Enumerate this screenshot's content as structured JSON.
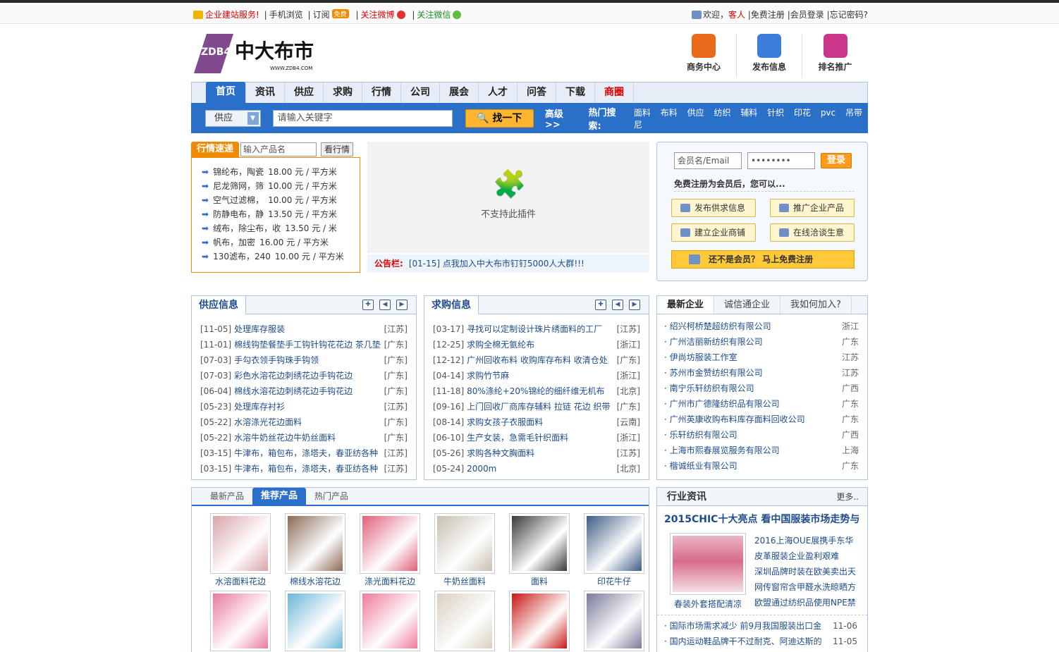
{
  "topbar": {
    "left": {
      "service": "企业建站服务!",
      "mobile": "手机浏览",
      "subscribe": "订阅",
      "free_badge": "免费",
      "weibo": "关注微博",
      "wechat": "关注微信"
    },
    "right": {
      "welcome": "欢迎，",
      "guest": "客人",
      "register": "免费注册",
      "login": "会员登录",
      "forgot": "忘记密码?"
    }
  },
  "header": {
    "logo_text": "中大布市",
    "logo_sub": "ZDB4",
    "logo_url_text": "WWW.ZDB4.COM",
    "icons": [
      {
        "label": "商务中心",
        "color": "#e86a1a"
      },
      {
        "label": "发布信息",
        "color": "#3b7dd8"
      },
      {
        "label": "排名推广",
        "color": "#c9368a"
      }
    ]
  },
  "nav": {
    "items": [
      "首页",
      "资讯",
      "供应",
      "求购",
      "行情",
      "公司",
      "展会",
      "人才",
      "问答",
      "下载",
      "商圈"
    ]
  },
  "search": {
    "category": "供应",
    "placeholder": "请输入关键字",
    "button": "找一下",
    "advanced": "高级 >>",
    "hot_label": "热门搜索:",
    "hot_words": [
      "面料",
      "布料",
      "供应",
      "纺织",
      "辅料",
      "针织",
      "印花",
      "pvc",
      "吊带",
      "尼"
    ]
  },
  "market": {
    "tab": "行情速递",
    "input_placeholder": "输入产品名",
    "button": "看行情",
    "rows": [
      {
        "name": "锦纶布，陶瓷",
        "price": "18.00 元 / 平方米"
      },
      {
        "name": "尼龙筛网，筛",
        "price": "10.00 元 / 平方米"
      },
      {
        "name": "空气过滤棉，",
        "price": "10.00 元 / 平方米"
      },
      {
        "name": "防静电布，静",
        "price": "13.50 元 / 平方米"
      },
      {
        "name": "绒布，除尘布，收",
        "price": "13.50 元 / 米"
      },
      {
        "name": "帆布，加密",
        "price": "16.00 元 / 平方米"
      },
      {
        "name": "130滤布，240",
        "price": "10.00 元 / 平方米"
      }
    ]
  },
  "plugin": {
    "text": "不支持此插件"
  },
  "notice": {
    "label": "公告栏:",
    "text": "[01-15] 点我加入中大布市钉钉5000人大群!!!"
  },
  "login": {
    "user_placeholder": "会员名/Email",
    "password_value": "••••••••",
    "button": "登录",
    "message": "免费注册为会员后，您可以...",
    "actions": [
      "发布供求信息",
      "推广企业产品",
      "建立企业商铺",
      "在线洽谈生意"
    ],
    "register": "还不是会员？ 马上免费注册"
  },
  "supply": {
    "title": "供应信息",
    "items": [
      {
        "date": "[11-05]",
        "title": "处理库存服装",
        "region": "[江苏]"
      },
      {
        "date": "[11-01]",
        "title": "棉线钩垫餐垫手工钩针钩花花边 茶几垫",
        "region": "[广东]"
      },
      {
        "date": "[07-03]",
        "title": "手勾衣领手钩珠手钩领",
        "region": "[广东]"
      },
      {
        "date": "[07-03]",
        "title": "彩色水溶花边刺绣花边手钩花边",
        "region": "[广东]"
      },
      {
        "date": "[06-04]",
        "title": "棉线水溶花边刺绣花边手钩花边",
        "region": "[广东]"
      },
      {
        "date": "[05-23]",
        "title": "处理库存衬衫",
        "region": "[江苏]"
      },
      {
        "date": "[05-22]",
        "title": "水溶涤光花边面料",
        "region": "[广东]"
      },
      {
        "date": "[05-22]",
        "title": "水溶牛奶丝花边牛奶丝面料",
        "region": "[广东]"
      },
      {
        "date": "[03-15]",
        "title": "牛津布，箱包布，涤塔夫，春亚纺各种",
        "region": "[江苏]"
      },
      {
        "date": "[03-15]",
        "title": "牛津布，箱包布，涤塔夫，春亚纺各种",
        "region": "[江苏]"
      }
    ]
  },
  "purchase": {
    "title": "求购信息",
    "items": [
      {
        "date": "[03-17]",
        "title": "寻找可以定制设计珠片绣面料的工厂",
        "region": "[江苏]"
      },
      {
        "date": "[12-25]",
        "title": "求购全棉无氨纶布",
        "region": "[浙江]"
      },
      {
        "date": "[12-12]",
        "title": "广州回收布料 收购库存布料 收清仓处",
        "region": "[广东]"
      },
      {
        "date": "[04-14]",
        "title": "求购竹节麻",
        "region": "[浙江]"
      },
      {
        "date": "[11-18]",
        "title": "80%涤纶+20%锦纶的细纤维无机布",
        "region": "[北京]"
      },
      {
        "date": "[09-16]",
        "title": "上门回收厂商库存辅料 拉链 花边 织带",
        "region": "[广东]"
      },
      {
        "date": "[08-14]",
        "title": "求购女孩子衣服面料",
        "region": "[云南]"
      },
      {
        "date": "[06-10]",
        "title": "生产女装，急需毛针织面料",
        "region": "[浙江]"
      },
      {
        "date": "[05-26]",
        "title": "求购各种文胸面料",
        "region": "[江苏]"
      },
      {
        "date": "[05-24]",
        "title": "2000m",
        "region": "[北京]"
      }
    ]
  },
  "companies": {
    "tabs": [
      "最新企业",
      "诚信通企业",
      "我如何加入?"
    ],
    "items": [
      {
        "name": "绍兴柯桥楚超纺织有限公司",
        "region": "浙江"
      },
      {
        "name": "广州洁丽新纺织有限公司",
        "region": "广东"
      },
      {
        "name": "伊尚坊服装工作室",
        "region": "江苏"
      },
      {
        "name": "苏州市金赞纺织有限公司",
        "region": "江苏"
      },
      {
        "name": "南宁乐轩纺织有限公司",
        "region": "广西"
      },
      {
        "name": "广州市广德隆纺织品有限公司",
        "region": "广东"
      },
      {
        "name": "广州英康收购布料库存面料回收公司",
        "region": "广东"
      },
      {
        "name": "乐轩纺织有限公司",
        "region": "广西"
      },
      {
        "name": "上海市熙春展览服务有限公司",
        "region": "上海"
      },
      {
        "name": "楷诚纸业有限公司",
        "region": "广东"
      }
    ]
  },
  "products": {
    "tabs": [
      "最新产品",
      "推荐产品",
      "热门产品"
    ],
    "items": [
      {
        "name": "水溶面料花边",
        "color": "#d9a3a8"
      },
      {
        "name": "棉线水溶花边",
        "color": "#8a6a55"
      },
      {
        "name": "涤光面料花边",
        "color": "#e0607a"
      },
      {
        "name": "牛奶丝面料",
        "color": "#c7c0b0"
      },
      {
        "name": "面料",
        "color": "#3a3a3a"
      },
      {
        "name": "印花牛仔",
        "color": "#3f5d86"
      },
      {
        "name": "",
        "color": "#e87aa0"
      },
      {
        "name": "",
        "color": "#6cb6d6"
      },
      {
        "name": "",
        "color": "#f07a9a"
      },
      {
        "name": "",
        "color": "#d8cfc0"
      },
      {
        "name": "",
        "color": "#c81818"
      },
      {
        "name": "",
        "color": "#7a7a9a"
      }
    ]
  },
  "news": {
    "title": "行业资讯",
    "more": "更多..",
    "headline": "2015CHIC十大亮点 看中国服装市场走势与",
    "image_caption": "春装外套搭配清凉",
    "side_items": [
      "2016上海OUE展携手东华",
      "皮革服装企业盈利艰难",
      "深圳品牌时装在欧美卖出天",
      "网传窗帘含甲醛水洗晾晒方",
      "欧盟通过纺织品使用NPE禁"
    ],
    "bottom_items": [
      {
        "title": "国际市场需求减少 前9月我国服装出口金",
        "date": "11-06"
      },
      {
        "title": "国内运动鞋品牌干不过耐克、阿迪达斯的",
        "date": "11-05"
      }
    ]
  }
}
